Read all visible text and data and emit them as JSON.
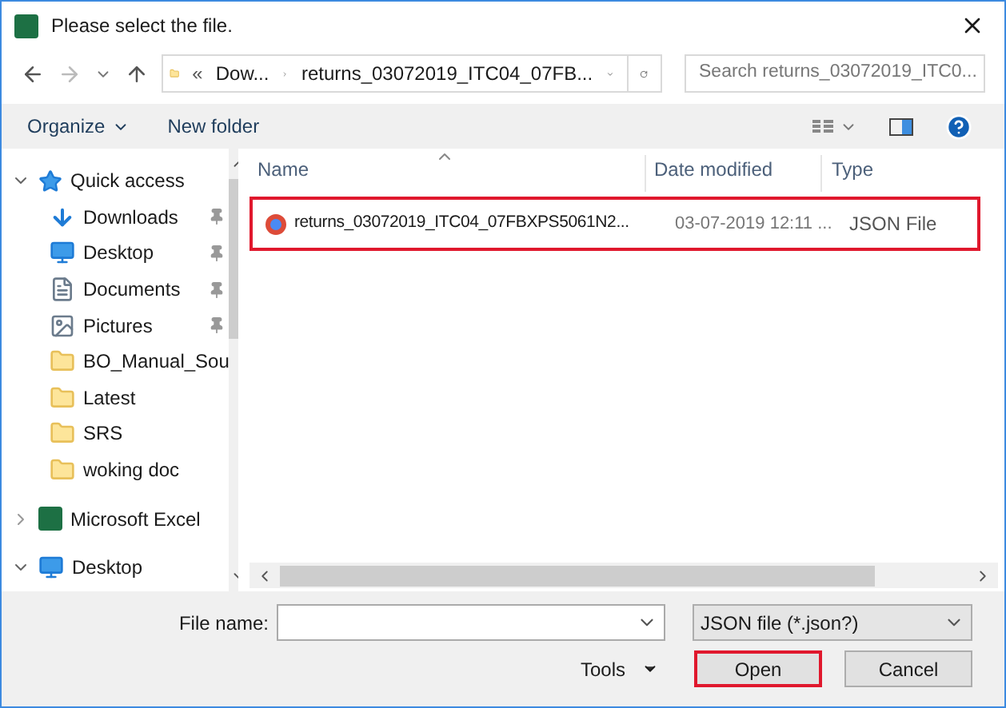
{
  "window": {
    "title": "Please select the file."
  },
  "address": {
    "overflow": "«",
    "crumbs": [
      "Dow...",
      "returns_03072019_ITC04_07FB..."
    ]
  },
  "search": {
    "placeholder": "Search returns_03072019_ITC0..."
  },
  "toolbar": {
    "organize": "Organize",
    "new_folder": "New folder"
  },
  "sidebar": {
    "items": [
      {
        "label": "Quick access",
        "kind": "star",
        "expanded": true,
        "children": [
          {
            "label": "Downloads",
            "kind": "download",
            "pinned": true
          },
          {
            "label": "Desktop",
            "kind": "monitor",
            "pinned": true
          },
          {
            "label": "Documents",
            "kind": "document",
            "pinned": true
          },
          {
            "label": "Pictures",
            "kind": "picture",
            "pinned": true
          },
          {
            "label": "BO_Manual_Sou",
            "kind": "folder",
            "pinned": false
          },
          {
            "label": "Latest",
            "kind": "folder",
            "pinned": false
          },
          {
            "label": "SRS",
            "kind": "folder",
            "pinned": false
          },
          {
            "label": "woking doc",
            "kind": "folder",
            "pinned": false
          }
        ]
      },
      {
        "label": "Microsoft Excel",
        "kind": "excel",
        "expanded": false
      },
      {
        "label": "Desktop",
        "kind": "monitor",
        "expanded": true
      }
    ]
  },
  "table": {
    "columns": [
      "Name",
      "Date modified",
      "Type"
    ],
    "rows": [
      {
        "name": "returns_03072019_ITC04_07FBXPS5061N2...",
        "date": "03-07-2019 12:11 ...",
        "type": "JSON File",
        "highlighted": true
      }
    ]
  },
  "footer": {
    "file_name_label": "File name:",
    "filter": "JSON file (*.json?)",
    "tools": "Tools",
    "buttons": [
      {
        "label": "Open",
        "highlighted": true
      },
      {
        "label": "Cancel",
        "highlighted": false
      }
    ]
  }
}
